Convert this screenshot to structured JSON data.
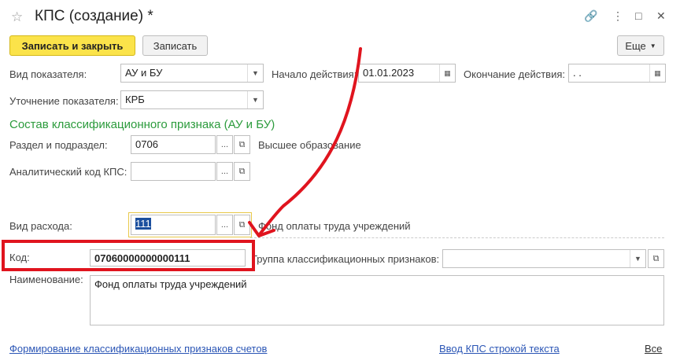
{
  "window": {
    "title": "КПС (создание) *"
  },
  "toolbar": {
    "save_close_label": "Записать и закрыть",
    "save_label": "Записать",
    "more_label": "Еще"
  },
  "form": {
    "indicator_type": {
      "label": "Вид показателя:",
      "value": "АУ и БУ"
    },
    "start_date": {
      "label": "Начало действия:",
      "value": "01.01.2023"
    },
    "end_date": {
      "label": "Окончание действия:",
      "value": " .  ."
    },
    "refinement": {
      "label": "Уточнение показателя:",
      "value": "КРБ"
    },
    "section_title": "Состав классификационного признака (АУ и БУ)",
    "division": {
      "label": "Раздел и подраздел:",
      "value": "0706",
      "description": "Высшее образование"
    },
    "analytic_code": {
      "label": "Аналитический код КПС:",
      "value": ""
    },
    "expense_type": {
      "label": "Вид расхода:",
      "value": "111",
      "description": "Фонд оплаты труда учреждений"
    },
    "code": {
      "label": "Код:",
      "value": "07060000000000111"
    },
    "group": {
      "label": "Группа классификационных признаков:",
      "value": ""
    },
    "name": {
      "label": "Наименование:",
      "value": "Фонд оплаты труда учреждений"
    }
  },
  "footer": {
    "link_left": "Формирование классификационных признаков счетов",
    "link_right": "Ввод КПС строкой текста",
    "link_all": "Все"
  },
  "colors": {
    "primary_button": "#fbe34a",
    "section_title": "#2b9b3c",
    "link": "#2a55b5",
    "annotation": "#e0141e"
  }
}
